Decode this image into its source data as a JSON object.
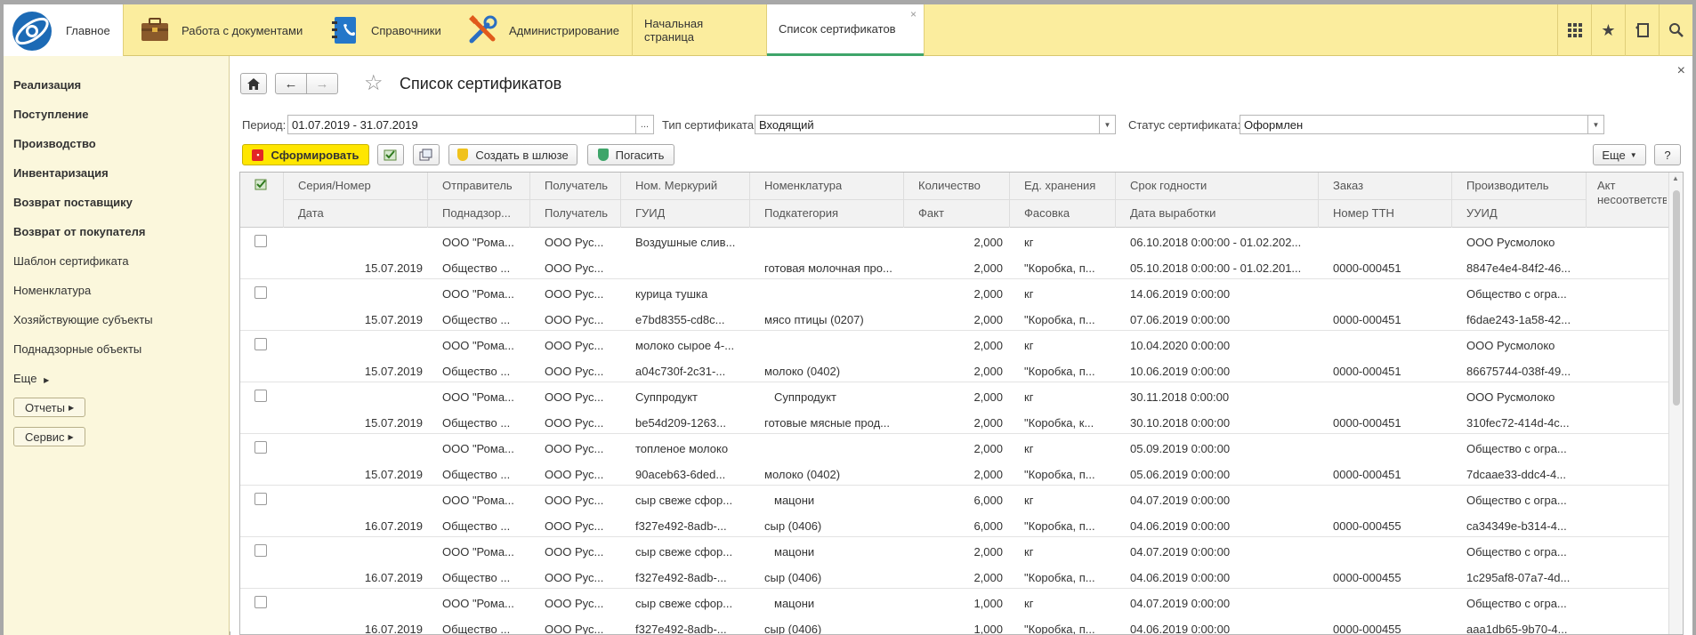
{
  "topbar": {
    "sections": [
      {
        "label": "Главное",
        "icon": "home-logo-icon"
      },
      {
        "label": "Работа с документами",
        "icon": "briefcase-icon"
      },
      {
        "label": "Справочники",
        "icon": "address-book-icon"
      },
      {
        "label": "Администрирование",
        "icon": "tools-icon"
      }
    ],
    "tabs": [
      {
        "label": "Начальная страница"
      },
      {
        "label": "Список сертификатов",
        "close": "×"
      }
    ],
    "right_icons": [
      "apps-grid-icon",
      "star-icon",
      "history-icon",
      "search-icon"
    ]
  },
  "sidebar": {
    "bold_items": [
      "Реализация",
      "Поступление",
      "Производство",
      "Инвентаризация",
      "Возврат поставщику",
      "Возврат от покупателя"
    ],
    "items": [
      "Шаблон сертификата",
      "Номенклатура",
      "Хозяйствующие субъекты",
      "Поднадзорные объекты"
    ],
    "more": "Еще",
    "buttons": [
      "Отчеты",
      "Сервис"
    ]
  },
  "form": {
    "title": "Список сертификатов",
    "close": "×",
    "period_label": "Период:",
    "period_value": "01.07.2019 - 31.07.2019",
    "period_btn": "...",
    "type_label": "Тип сертификата:",
    "type_value": "Входящий",
    "status_label": "Статус сертификата:",
    "status_value": "Оформлен"
  },
  "toolbar": {
    "generate": "Сформировать",
    "create_gateway": "Создать в шлюзе",
    "redeem": "Погасить",
    "more": "Еще",
    "help": "?"
  },
  "table": {
    "header_top": [
      "Серия/Номер",
      "Отправитель",
      "Получатель",
      "Ном. Меркурий",
      "Номенклатура",
      "Количество",
      "Ед. хранения",
      "Срок годности",
      "Заказ",
      "Производитель",
      "Акт несоответств..."
    ],
    "header_bottom": [
      "Дата",
      "Поднадзор...",
      "Получатель",
      "ГУИД",
      "Подкатегория",
      "Факт",
      "Фасовка",
      "Дата выработки",
      "Номер ТТН",
      "УУИД"
    ],
    "rows": [
      {
        "sender": "ООО \"Рома...",
        "recipient": "ООО Рус...",
        "merc": "Воздушные слив...",
        "nom": "",
        "qty": "2,000",
        "unit": "кг",
        "expiry": "06.10.2018 0:00:00 - 01.02.202...",
        "order": "",
        "producer": "ООО Русмолоко",
        "date": "15.07.2019",
        "sub": "Общество ...",
        "recipient2": "ООО Рус...",
        "guid": "",
        "subcat": "готовая молочная про...",
        "fact": "2,000",
        "pack": "\"Коробка, п...",
        "made": "05.10.2018 0:00:00 - 01.02.201...",
        "ttn": "0000-000451",
        "uuid": "8847e4e4-84f2-46..."
      },
      {
        "sender": "ООО \"Рома...",
        "recipient": "ООО Рус...",
        "merc": "курица тушка",
        "nom": "",
        "qty": "2,000",
        "unit": "кг",
        "expiry": "14.06.2019 0:00:00",
        "order": "",
        "producer": "Общество с огра...",
        "date": "15.07.2019",
        "sub": "Общество ...",
        "recipient2": "ООО Рус...",
        "guid": "e7bd8355-cd8c...",
        "subcat": "мясо птицы (0207)",
        "fact": "2,000",
        "pack": "\"Коробка, п...",
        "made": "07.06.2019 0:00:00",
        "ttn": "0000-000451",
        "uuid": "f6dae243-1a58-42..."
      },
      {
        "sender": "ООО \"Рома...",
        "recipient": "ООО Рус...",
        "merc": "молоко сырое 4-...",
        "nom": "",
        "qty": "2,000",
        "unit": "кг",
        "expiry": "10.04.2020 0:00:00",
        "order": "",
        "producer": "ООО Русмолоко",
        "date": "15.07.2019",
        "sub": "Общество ...",
        "recipient2": "ООО Рус...",
        "guid": "a04c730f-2c31-...",
        "subcat": "молоко (0402)",
        "fact": "2,000",
        "pack": "\"Коробка, п...",
        "made": "10.06.2019 0:00:00",
        "ttn": "0000-000451",
        "uuid": "86675744-038f-49..."
      },
      {
        "sender": "ООО \"Рома...",
        "recipient": "ООО Рус...",
        "merc": "Суппродукт",
        "nom": "Суппродукт",
        "qty": "2,000",
        "unit": "кг",
        "expiry": "30.11.2018 0:00:00",
        "order": "",
        "producer": "ООО Русмолоко",
        "date": "15.07.2019",
        "sub": "Общество ...",
        "recipient2": "ООО Рус...",
        "guid": "be54d209-1263...",
        "subcat": "готовые мясные прод...",
        "fact": "2,000",
        "pack": "\"Коробка, к...",
        "made": "30.10.2018 0:00:00",
        "ttn": "0000-000451",
        "uuid": "310fec72-414d-4c..."
      },
      {
        "sender": "ООО \"Рома...",
        "recipient": "ООО Рус...",
        "merc": "топленое молоко",
        "nom": "",
        "qty": "2,000",
        "unit": "кг",
        "expiry": "05.09.2019 0:00:00",
        "order": "",
        "producer": "Общество с огра...",
        "date": "15.07.2019",
        "sub": "Общество ...",
        "recipient2": "ООО Рус...",
        "guid": "90aceb63-6ded...",
        "subcat": "молоко (0402)",
        "fact": "2,000",
        "pack": "\"Коробка, п...",
        "made": "05.06.2019 0:00:00",
        "ttn": "0000-000451",
        "uuid": "7dcaae33-ddc4-4..."
      },
      {
        "sender": "ООО \"Рома...",
        "recipient": "ООО Рус...",
        "merc": "сыр свеже сфор...",
        "nom": "мацони",
        "qty": "6,000",
        "unit": "кг",
        "expiry": "04.07.2019 0:00:00",
        "order": "",
        "producer": "Общество с огра...",
        "date": "16.07.2019",
        "sub": "Общество ...",
        "recipient2": "ООО Рус...",
        "guid": "f327e492-8adb-...",
        "subcat": "сыр (0406)",
        "fact": "6,000",
        "pack": "\"Коробка, п...",
        "made": "04.06.2019 0:00:00",
        "ttn": "0000-000455",
        "uuid": "ca34349e-b314-4..."
      },
      {
        "sender": "ООО \"Рома...",
        "recipient": "ООО Рус...",
        "merc": "сыр свеже сфор...",
        "nom": "мацони",
        "qty": "2,000",
        "unit": "кг",
        "expiry": "04.07.2019 0:00:00",
        "order": "",
        "producer": "Общество с огра...",
        "date": "16.07.2019",
        "sub": "Общество ...",
        "recipient2": "ООО Рус...",
        "guid": "f327e492-8adb-...",
        "subcat": "сыр (0406)",
        "fact": "2,000",
        "pack": "\"Коробка, п...",
        "made": "04.06.2019 0:00:00",
        "ttn": "0000-000455",
        "uuid": "1c295af8-07a7-4d..."
      },
      {
        "sender": "ООО \"Рома...",
        "recipient": "ООО Рус...",
        "merc": "сыр свеже сфор...",
        "nom": "мацони",
        "qty": "1,000",
        "unit": "кг",
        "expiry": "04.07.2019 0:00:00",
        "order": "",
        "producer": "Общество с огра...",
        "date": "16.07.2019",
        "sub": "Общество ...",
        "recipient2": "ООО Рус...",
        "guid": "f327e492-8adb-...",
        "subcat": "сыр (0406)",
        "fact": "1,000",
        "pack": "\"Коробка, п...",
        "made": "04.06.2019 0:00:00",
        "ttn": "0000-000455",
        "uuid": "aaa1db65-9b70-4..."
      }
    ]
  }
}
